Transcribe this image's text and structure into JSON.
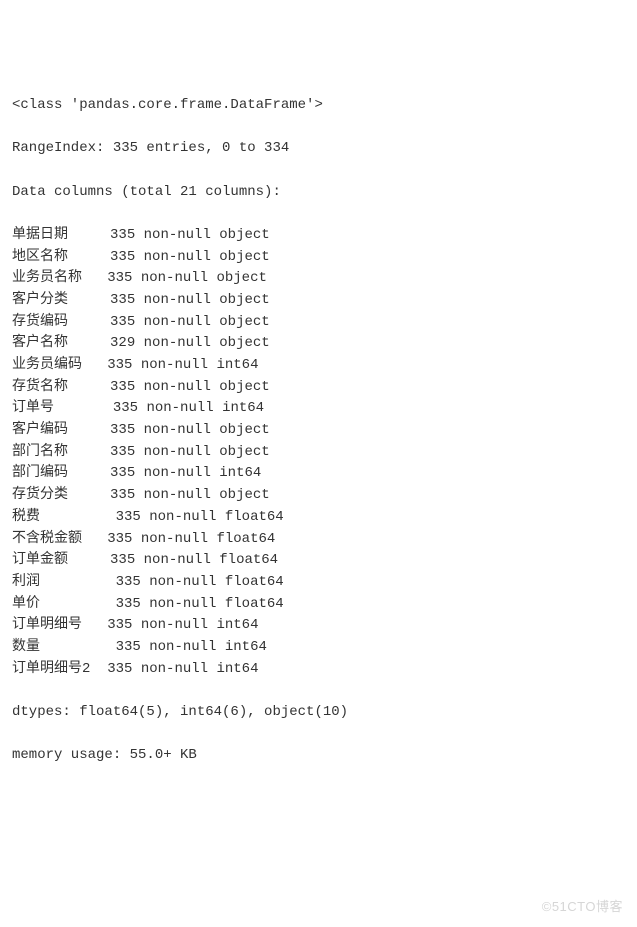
{
  "header": {
    "class_line": "<class 'pandas.core.frame.DataFrame'>",
    "range_index": "RangeIndex: 335 entries, 0 to 334",
    "columns_header": "Data columns (total 21 columns):"
  },
  "columns": [
    {
      "name": "单据日期",
      "count": 335,
      "dtype": "object"
    },
    {
      "name": "地区名称",
      "count": 335,
      "dtype": "object"
    },
    {
      "name": "业务员名称",
      "count": 335,
      "dtype": "object"
    },
    {
      "name": "客户分类",
      "count": 335,
      "dtype": "object"
    },
    {
      "name": "存货编码",
      "count": 335,
      "dtype": "object"
    },
    {
      "name": "客户名称",
      "count": 329,
      "dtype": "object"
    },
    {
      "name": "业务员编码",
      "count": 335,
      "dtype": "int64"
    },
    {
      "name": "存货名称",
      "count": 335,
      "dtype": "object"
    },
    {
      "name": "订单号",
      "count": 335,
      "dtype": "int64"
    },
    {
      "name": "客户编码",
      "count": 335,
      "dtype": "object"
    },
    {
      "name": "部门名称",
      "count": 335,
      "dtype": "object"
    },
    {
      "name": "部门编码",
      "count": 335,
      "dtype": "int64"
    },
    {
      "name": "存货分类",
      "count": 335,
      "dtype": "object"
    },
    {
      "name": "税费",
      "count": 335,
      "dtype": "float64"
    },
    {
      "name": "不含税金额",
      "count": 335,
      "dtype": "float64"
    },
    {
      "name": "订单金额",
      "count": 335,
      "dtype": "float64"
    },
    {
      "name": "利润",
      "count": 335,
      "dtype": "float64"
    },
    {
      "name": "单价",
      "count": 335,
      "dtype": "float64"
    },
    {
      "name": "订单明细号",
      "count": 335,
      "dtype": "int64"
    },
    {
      "name": "数量",
      "count": 335,
      "dtype": "int64"
    },
    {
      "name": "订单明细号2",
      "count": 335,
      "dtype": "int64"
    }
  ],
  "footer": {
    "dtypes": "dtypes: float64(5), int64(6), object(10)",
    "memory": "memory usage: 55.0+ KB"
  },
  "watermark": "©51CTO博客",
  "layout": {
    "name_width": 12,
    "nonnull_label": "non-null"
  }
}
